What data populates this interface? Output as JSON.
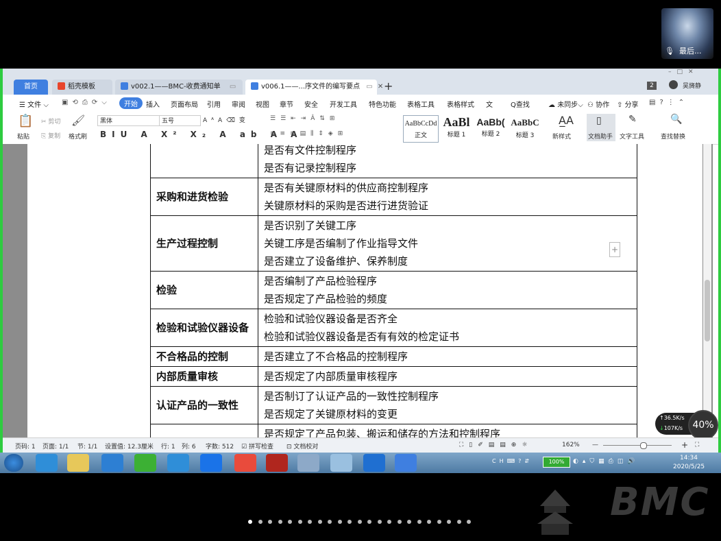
{
  "video": {
    "participant_name": "最后..."
  },
  "tabs": {
    "home": "首页",
    "daoke": "稻壳模板",
    "doc1": "v002.1——BMC-收费通知单",
    "doc2": "v006.1——...序文件的编写要点",
    "new_tab": "+"
  },
  "title_right": {
    "badge": "2",
    "user": "吴旖静"
  },
  "menu": {
    "file": "文件",
    "start": "开始",
    "items": [
      "插入",
      "页面布局",
      "引用",
      "审阅",
      "视图",
      "章节",
      "安全",
      "开发工具",
      "特色功能",
      "表格工具",
      "表格样式",
      "文"
    ],
    "search": "Q查找",
    "sync": "未同步",
    "collab": "协作",
    "share": "分享"
  },
  "ribbon": {
    "paste": "粘贴",
    "cut": "剪切",
    "copy": "复制",
    "format_painter": "格式刷",
    "font_name": "黑体",
    "font_size": "五号",
    "styles": [
      {
        "preview": "AaBbCcDd",
        "label": "正文"
      },
      {
        "preview": "AaBl",
        "label": "标题 1"
      },
      {
        "preview": "AaBb(",
        "label": "标题 2"
      },
      {
        "preview": "AaBbC",
        "label": "标题 3"
      }
    ],
    "new_style": "新样式",
    "doc_helper": "文档助手",
    "text_tools": "文字工具",
    "find_replace": "查找替换"
  },
  "table_rows": [
    {
      "key": "",
      "values": [
        "是否有文件控制程序",
        "是否有记录控制程序"
      ]
    },
    {
      "key": "采购和进货检验",
      "values": [
        "是否有关键原材料的供应商控制程序",
        "关键原材料的采购是否进行进货验证"
      ]
    },
    {
      "key": "生产过程控制",
      "values": [
        "是否识别了关键工序",
        "关键工序是否编制了作业指导文件",
        "是否建立了设备维护、保养制度"
      ]
    },
    {
      "key": "检验",
      "values": [
        "是否编制了产品检验程序",
        "是否规定了产品检验的频度"
      ]
    },
    {
      "key": "检验和试验仪器设备",
      "values": [
        "检验和试验仪器设备是否齐全",
        "检验和试验仪器设备是否有有效的检定证书"
      ]
    },
    {
      "key": "不合格品的控制",
      "values": [
        "是否建立了不合格品的控制程序"
      ]
    },
    {
      "key": "内部质量审核",
      "values": [
        "是否规定了内部质量审核程序"
      ]
    },
    {
      "key": "认证产品的一致性",
      "values": [
        "是否制订了认证产品的一致性控制程序",
        "是否规定了关键原材料的变更"
      ]
    },
    {
      "key": "",
      "values": [
        "是否规定了产品包装、搬运和储存的方法和控制程序"
      ]
    }
  ],
  "statusbar": {
    "page_no": "页码: 1",
    "pages": "页面: 1/1",
    "section": "节: 1/1",
    "setting": "设置值: 12.3厘米",
    "row": "行: 1",
    "col": "列: 6",
    "words": "字数: 512",
    "spell": "拼写检查",
    "proof": "文档校对",
    "zoom": "162%"
  },
  "network": {
    "up": "36.5K/s",
    "down": "107K/s",
    "percent": "40%"
  },
  "taskbar": {
    "battery": "100%",
    "time": "14:34",
    "date": "2020/5/25"
  },
  "logo_text": "BMC"
}
